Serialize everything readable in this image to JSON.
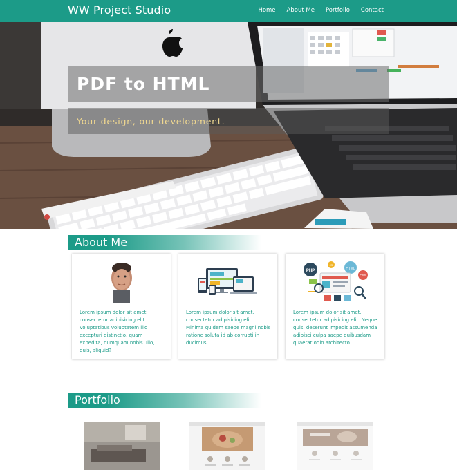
{
  "navbar": {
    "brand": "WW Project Studio",
    "links": [
      "Home",
      "About Me",
      "Portfolio",
      "Contact"
    ]
  },
  "hero": {
    "title": "PDF to HTML",
    "subtitle": "Your design, our development."
  },
  "about": {
    "heading": "About Me",
    "cards": [
      {
        "icon": "portrait-photo",
        "text": "Lorem ipsum dolor sit amet, consectetur adipisicing elit. Voluptatibus voluptatem illo excepturi distinctio, quam expedita, numquam nobis. Illo, quis, aliquid?"
      },
      {
        "icon": "responsive-devices-icon",
        "text": "Lorem ipsum dolor sit amet, consectetur adipisicing elit. Minima quidem saepe magni nobis ratione soluta id ab corrupti in ducimus."
      },
      {
        "icon": "web-technologies-icon",
        "text": "Lorem ipsum dolor sit amet, consectetur adipisicing elit. Neque quis, deserunt impedit assumenda adipisci culpa saepe quibusdam quaerat odio architecto!"
      }
    ]
  },
  "portfolio": {
    "heading": "Portfolio"
  },
  "colors": {
    "accent": "#1c9b88",
    "hero_subtitle": "#f0d890"
  }
}
